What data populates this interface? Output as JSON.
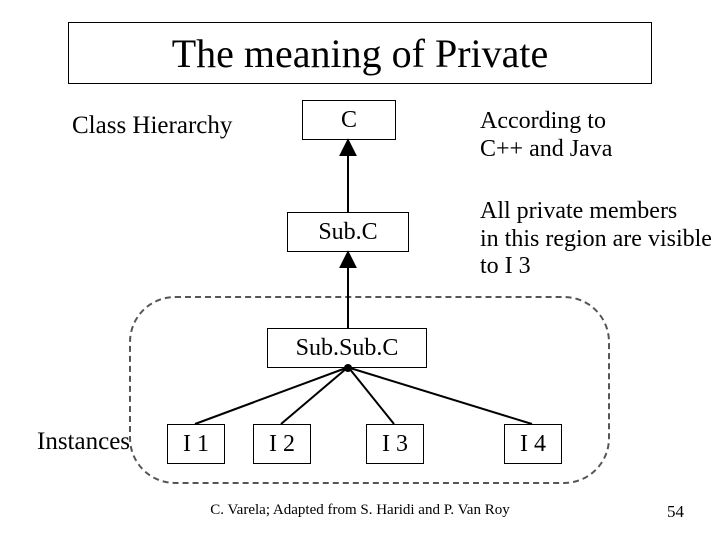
{
  "title": "The meaning of Private",
  "labels": {
    "class_hierarchy": "Class Hierarchy",
    "instances": "Instances"
  },
  "nodes": {
    "c": "C",
    "subc": "Sub.C",
    "subsubc": "Sub.Sub.C",
    "i1": "I 1",
    "i2": "I 2",
    "i3": "I 3",
    "i4": "I 4"
  },
  "notes": {
    "according_line1": "According to",
    "according_line2": "C++ and Java",
    "private_line1": "All private members",
    "private_line2": "in this region are visible",
    "private_line3": "to I 3"
  },
  "footer": "C. Varela; Adapted from S. Haridi and P. Van Roy",
  "page_number": "54"
}
